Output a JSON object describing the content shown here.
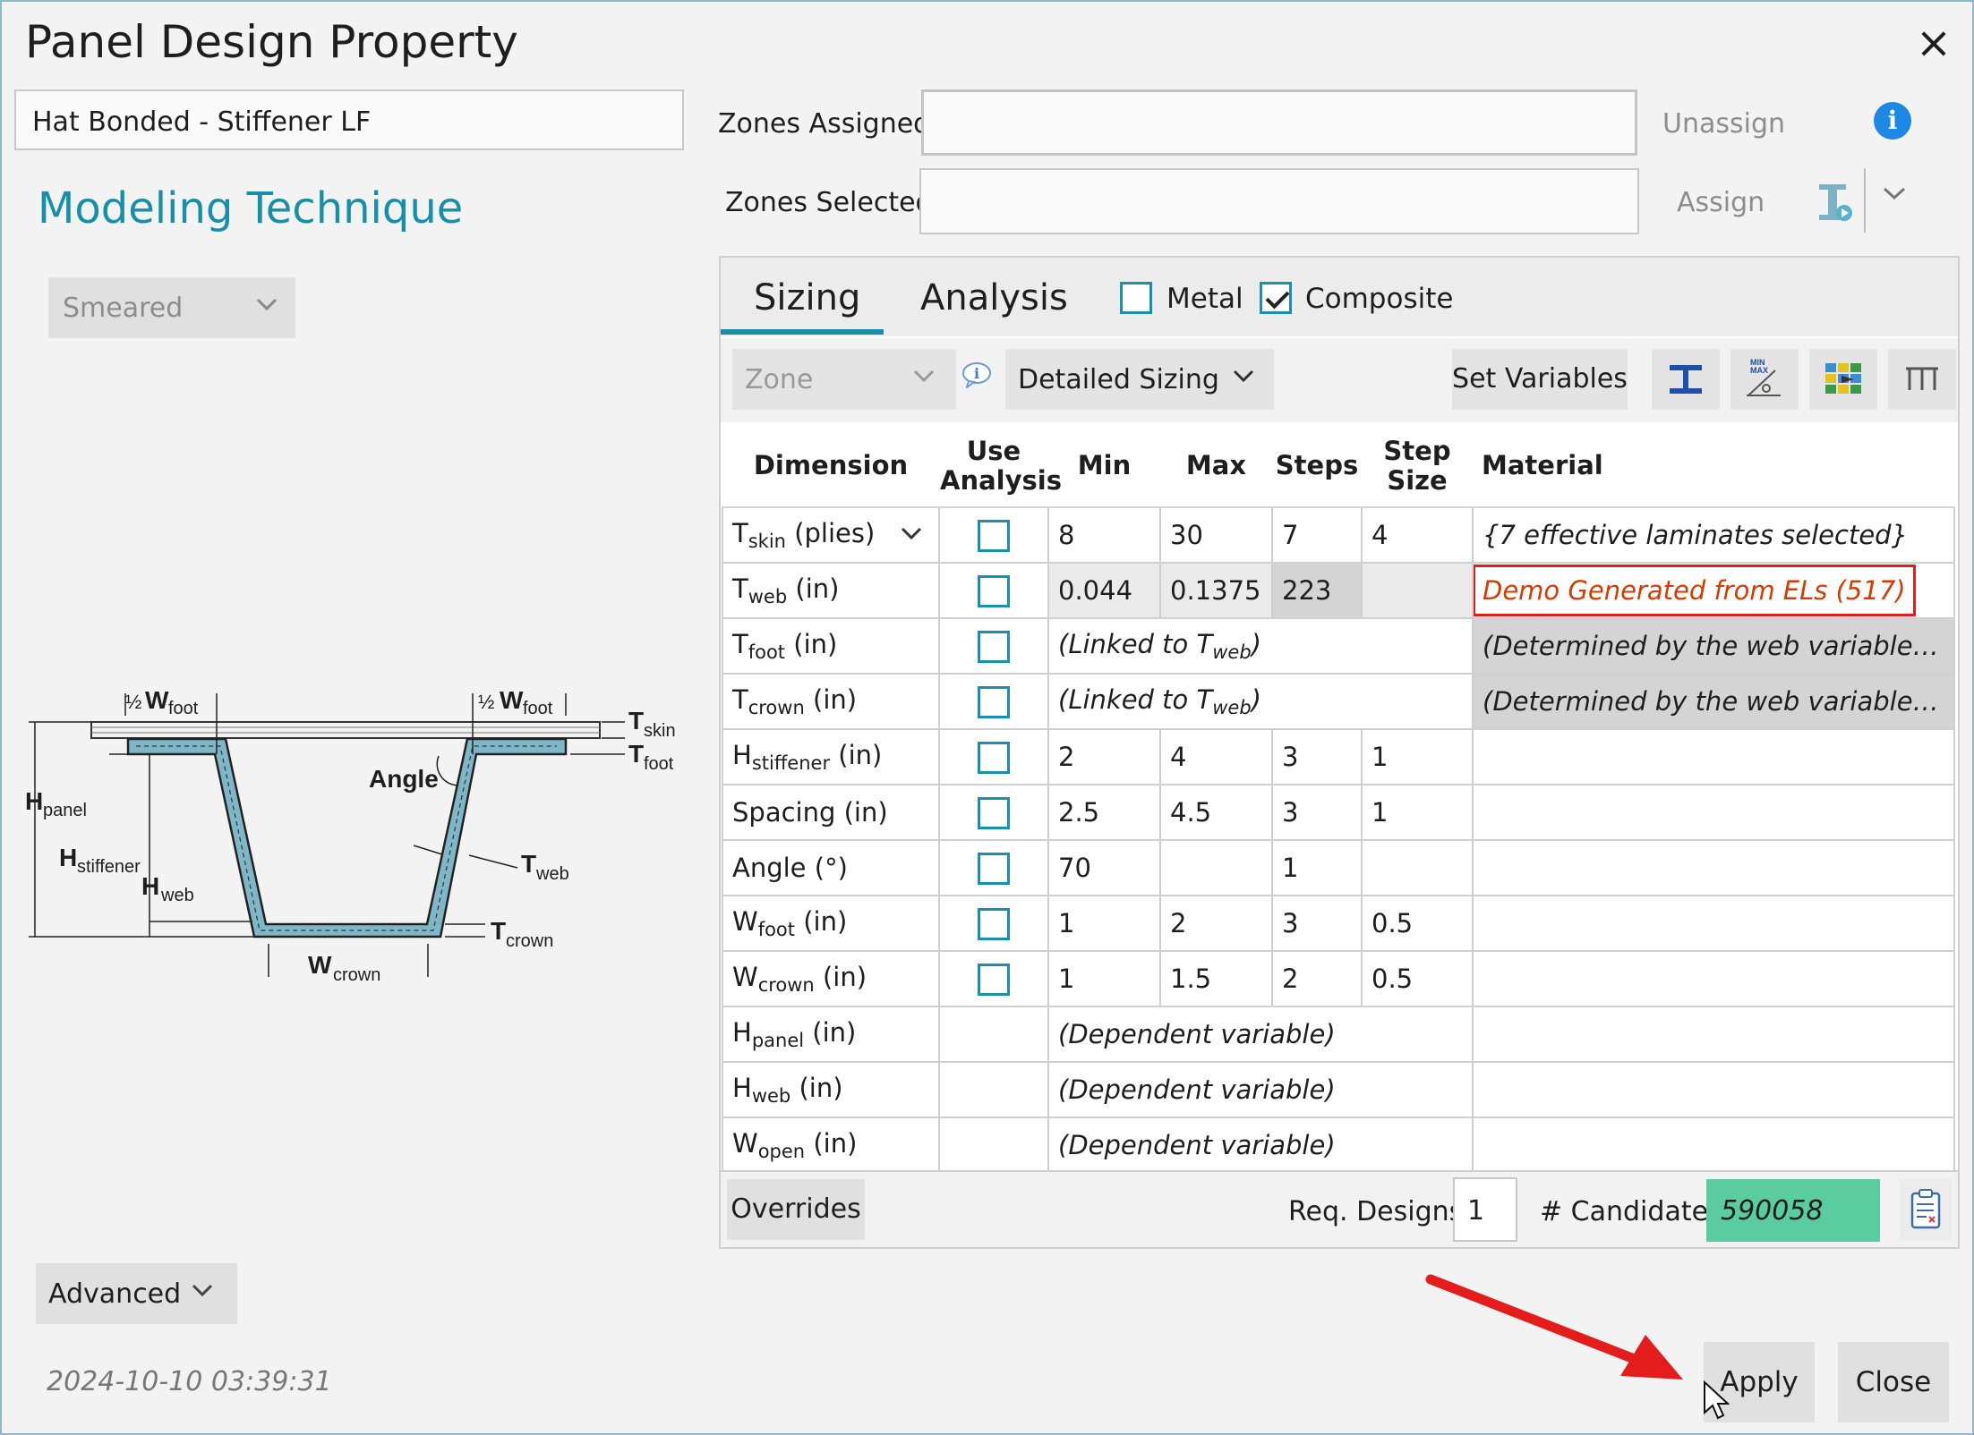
{
  "window": {
    "title": "Panel Design Property",
    "close_glyph": "×"
  },
  "left": {
    "panel_name": "Hat Bonded - Stiffener LF",
    "modeling_title": "Modeling Technique",
    "technique_value": "Smeared",
    "advanced_label": "Advanced",
    "timestamp": "2024-10-10 03:39:31"
  },
  "diagram": {
    "labels": {
      "half_w_foot": "½ W",
      "foot_sub": "foot",
      "t_skin": "T",
      "skin": "skin",
      "t_foot": "T",
      "foot": "foot",
      "h_panel": "H",
      "panel": "panel",
      "h_stiffener": "H",
      "stiffener": "stiffener",
      "h_web": "H",
      "web": "web",
      "angle": "Angle",
      "t_web": "T",
      "t_crown": "T",
      "crown": "crown",
      "w_crown": "W"
    },
    "colors": {
      "fill": "#7fb6c8",
      "stroke": "#222222"
    }
  },
  "zones": {
    "assigned_label": "Zones Assigned:",
    "selected_label": "Zones Selected:",
    "assigned_value": "",
    "selected_value": "",
    "unassign_label": "Unassign",
    "assign_label": "Assign",
    "info_glyph": "i"
  },
  "tabs": {
    "sizing": "Sizing",
    "analysis": "Analysis",
    "metal_label": "Metal",
    "metal_checked": false,
    "composite_label": "Composite",
    "composite_checked": true
  },
  "toolbar": {
    "zone_placeholder": "Zone",
    "mode_value": "Detailed Sizing",
    "set_variables": "Set Variables"
  },
  "table": {
    "headers": {
      "dimension": "Dimension",
      "use_analysis_1": "Use",
      "use_analysis_2": "Analysis",
      "min": "Min",
      "max": "Max",
      "steps": "Steps",
      "step_size_1": "Step",
      "step_size_2": "Size",
      "material": "Material"
    },
    "rows": [
      {
        "sym": "T",
        "sub": "skin",
        "unit": "(plies)",
        "min": "8",
        "max": "30",
        "steps": "7",
        "step_size": "4",
        "material": "{7 effective laminates selected}"
      },
      {
        "sym": "T",
        "sub": "web",
        "unit": "(in)",
        "min": "0.044",
        "max": "0.1375",
        "steps": "223",
        "step_size": "",
        "material": "Demo Generated from ELs (517)"
      },
      {
        "sym": "T",
        "sub": "foot",
        "unit": "(in)",
        "linked": "(Linked to T",
        "linked_sub": "web",
        "linked_end": ")",
        "material": "(Determined by the web variable's mater..."
      },
      {
        "sym": "T",
        "sub": "crown",
        "unit": "(in)",
        "linked": "(Linked to T",
        "linked_sub": "web",
        "linked_end": ")",
        "material": "(Determined by the web variable's mater..."
      },
      {
        "sym": "H",
        "sub": "stiffener",
        "unit": "(in)",
        "min": "2",
        "max": "4",
        "steps": "3",
        "step_size": "1"
      },
      {
        "sym": "Spacing",
        "unit": "(in)",
        "min": "2.5",
        "max": "4.5",
        "steps": "3",
        "step_size": "1"
      },
      {
        "sym": "Angle",
        "unit": "(°)",
        "min": "70",
        "max": "",
        "steps": "1",
        "step_size": ""
      },
      {
        "sym": "W",
        "sub": "foot",
        "unit": "(in)",
        "min": "1",
        "max": "2",
        "steps": "3",
        "step_size": "0.5"
      },
      {
        "sym": "W",
        "sub": "crown",
        "unit": "(in)",
        "min": "1",
        "max": "1.5",
        "steps": "2",
        "step_size": "0.5"
      },
      {
        "sym": "H",
        "sub": "panel",
        "unit": "(in)",
        "dependent": "(Dependent variable)"
      },
      {
        "sym": "H",
        "sub": "web",
        "unit": "(in)",
        "dependent": "(Dependent variable)"
      },
      {
        "sym": "W",
        "sub": "open",
        "unit": "(in)",
        "dependent": "(Dependent variable)"
      }
    ]
  },
  "bottom": {
    "overrides": "Overrides",
    "req_designs_label": "Req. Designs",
    "req_designs_value": "1",
    "candidates_label": "# Candidates",
    "candidates_value": "590058"
  },
  "actions": {
    "apply": "Apply",
    "close": "Close"
  },
  "colors": {
    "accent": "#178fa8",
    "checkbox": "#1a8fb0",
    "candidates_bg": "#5bcca0",
    "highlight_red": "#e31c1c",
    "material_text": "#d83b01"
  }
}
